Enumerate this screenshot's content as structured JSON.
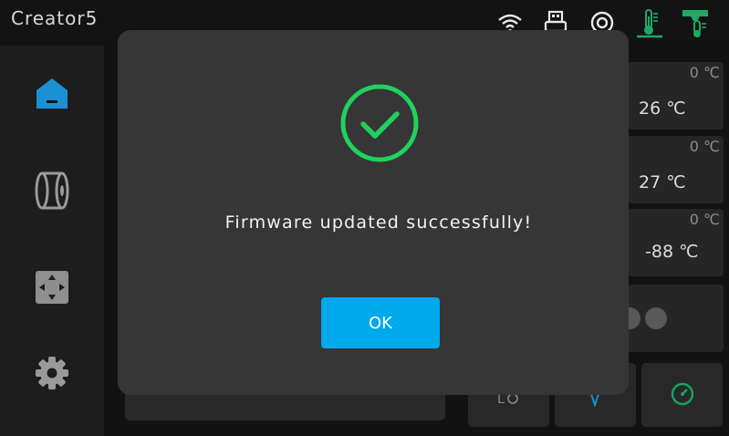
{
  "header": {
    "app_title": "Creator5",
    "status_icons": [
      "wifi-icon",
      "usb-icon",
      "camera-icon",
      "bed-temperature-icon",
      "extruder-temperature-icon"
    ]
  },
  "sidebar": {
    "items": [
      {
        "icon": "home-icon",
        "active": true
      },
      {
        "icon": "filament-spool-icon",
        "active": false
      },
      {
        "icon": "move-axis-icon",
        "active": false
      },
      {
        "icon": "settings-gear-icon",
        "active": false
      }
    ]
  },
  "temperatures": [
    {
      "target": "0 ℃",
      "current": "26 ℃"
    },
    {
      "target": "0 ℃",
      "current": "27 ℃"
    },
    {
      "target": "0 ℃",
      "current": "-88 ℃"
    }
  ],
  "bottom_controls": [
    "led-light-icon",
    "bulb-icon",
    "speed-gauge-icon"
  ],
  "colors": {
    "accent": "#00a8ec",
    "success": "#1fd15e",
    "active_icon": "#1a8fd1",
    "gauge_icon": "#17a35e"
  },
  "dialog": {
    "message": "Firmware updated successfully!",
    "ok_label": "OK",
    "icon": "success-check-icon"
  }
}
